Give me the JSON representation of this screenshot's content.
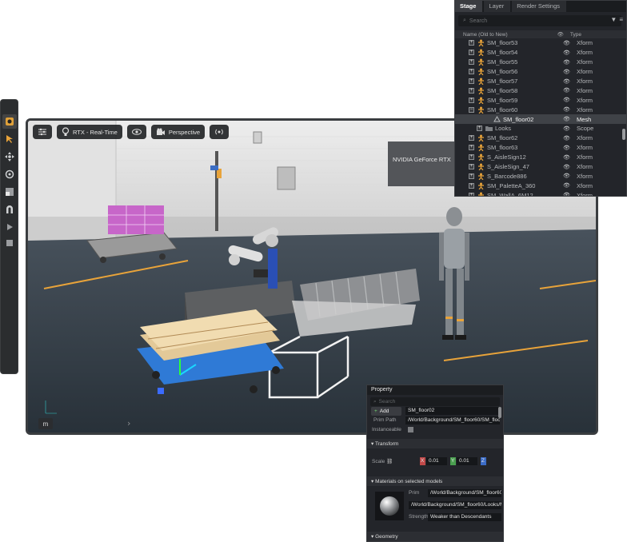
{
  "toolbar": {
    "tools": [
      {
        "name": "select-tool",
        "icon": "arrow-cursor-icon"
      },
      {
        "name": "move-tool",
        "icon": "move-icon"
      },
      {
        "name": "rotate-tool",
        "icon": "rotate-icon"
      },
      {
        "name": "scale-tool",
        "icon": "scale-icon"
      },
      {
        "name": "snap-tool",
        "icon": "magnet-icon"
      },
      {
        "name": "play-tool",
        "icon": "play-icon"
      },
      {
        "name": "stop-tool",
        "icon": "stop-icon"
      }
    ]
  },
  "viewport": {
    "renderer_label": "RTX - Real-Time",
    "camera_label": "Perspective",
    "gpu_label": "NVIDIA GeForce RTX",
    "bottom_badge": "m",
    "colors": {
      "accent_orange": "#e8a33a",
      "robot_blue": "#2a4fb5",
      "cart_blue": "#2f7ad6"
    }
  },
  "stage": {
    "tabs": [
      "Stage",
      "Layer",
      "Render Settings"
    ],
    "active_tab": "Stage",
    "search_placeholder": "Search",
    "columns": {
      "name": "Name (Old to New)",
      "type": "Type"
    },
    "rows": [
      {
        "name": "SM_floor53",
        "type": "Xform",
        "expander": "+",
        "icon": "xform-icon"
      },
      {
        "name": "SM_floor54",
        "type": "Xform",
        "expander": "+",
        "icon": "xform-icon"
      },
      {
        "name": "SM_floor55",
        "type": "Xform",
        "expander": "+",
        "icon": "xform-icon"
      },
      {
        "name": "SM_floor56",
        "type": "Xform",
        "expander": "+",
        "icon": "xform-icon"
      },
      {
        "name": "SM_floor57",
        "type": "Xform",
        "expander": "+",
        "icon": "xform-icon"
      },
      {
        "name": "SM_floor58",
        "type": "Xform",
        "expander": "+",
        "icon": "xform-icon"
      },
      {
        "name": "SM_floor59",
        "type": "Xform",
        "expander": "+",
        "icon": "xform-icon"
      },
      {
        "name": "SM_floor60",
        "type": "Xform",
        "expander": "−",
        "icon": "xform-icon"
      },
      {
        "name": "SM_floor02",
        "type": "Mesh",
        "expander": "",
        "icon": "mesh-icon",
        "selected": true,
        "indent": 2
      },
      {
        "name": "Looks",
        "type": "Scope",
        "expander": "+",
        "icon": "folder-icon",
        "indent": 1
      },
      {
        "name": "SM_floor62",
        "type": "Xform",
        "expander": "+",
        "icon": "xform-icon"
      },
      {
        "name": "SM_floor63",
        "type": "Xform",
        "expander": "+",
        "icon": "xform-icon"
      },
      {
        "name": "S_AisleSign12",
        "type": "Xform",
        "expander": "+",
        "icon": "xform-icon"
      },
      {
        "name": "S_AisleSign_47",
        "type": "Xform",
        "expander": "+",
        "icon": "xform-icon"
      },
      {
        "name": "S_Barcode886",
        "type": "Xform",
        "expander": "+",
        "icon": "xform-icon"
      },
      {
        "name": "SM_PaletteA_360",
        "type": "Xform",
        "expander": "+",
        "icon": "xform-icon"
      },
      {
        "name": "SM_WallA_6M12",
        "type": "Xform",
        "expander": "+",
        "icon": "xform-icon"
      }
    ]
  },
  "property": {
    "tab": "Property",
    "search_placeholder": "Search",
    "add_label": "Add",
    "prim_name": "SM_floor02",
    "prim_path_label": "Prim Path",
    "prim_path": "/World/Background/SM_floor60/SM_floor",
    "instanceable_label": "Instanceable",
    "transform_section": "Transform",
    "scale_label": "Scale",
    "scale_x": "0.01",
    "scale_y": "0.01",
    "scale_axes": [
      "X",
      "Y",
      "Z"
    ],
    "materials_section": "Materials on selected models",
    "mat_prim_label": "Prim",
    "mat_prim": "/World/Background/SM_floor60",
    "mat_path": "/World/Background/SM_floor60/Looks/M",
    "strength_label": "Strength",
    "strength_value": "Weaker than Descendants",
    "geometry_section": "Geometry"
  }
}
